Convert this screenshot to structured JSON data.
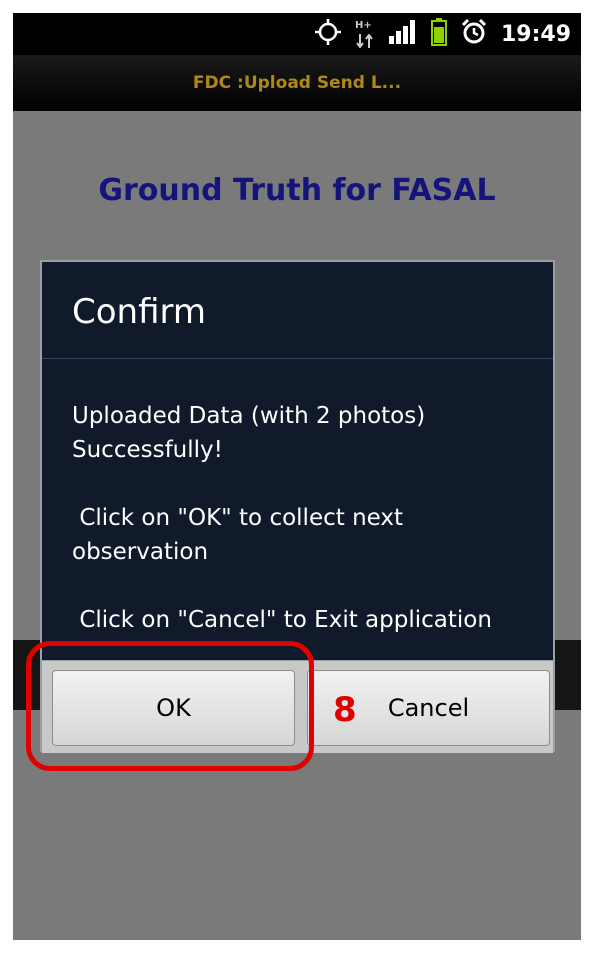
{
  "status_bar": {
    "time": "19:49",
    "icons": [
      "gps-icon",
      "data-transfer-icon",
      "signal-icon",
      "battery-icon",
      "alarm-icon"
    ],
    "network_label": "H+"
  },
  "app_titlebar": {
    "title": "FDC :Upload Send L..."
  },
  "app_heading": "Ground Truth for FASAL",
  "dialog": {
    "title": "Confirm",
    "message": "Uploaded Data (with 2 photos)\nSuccessfully!\n\n Click on \"OK\" to collect next\nobservation\n\n Click on \"Cancel\" to Exit application",
    "ok_label": "OK",
    "cancel_label": "Cancel"
  },
  "annotation": {
    "step_number": "8",
    "highlight_color": "#e00000"
  },
  "colors": {
    "heading": "#14147a",
    "titlebar_text": "#b08818",
    "dialog_bg": "#101a2a"
  }
}
